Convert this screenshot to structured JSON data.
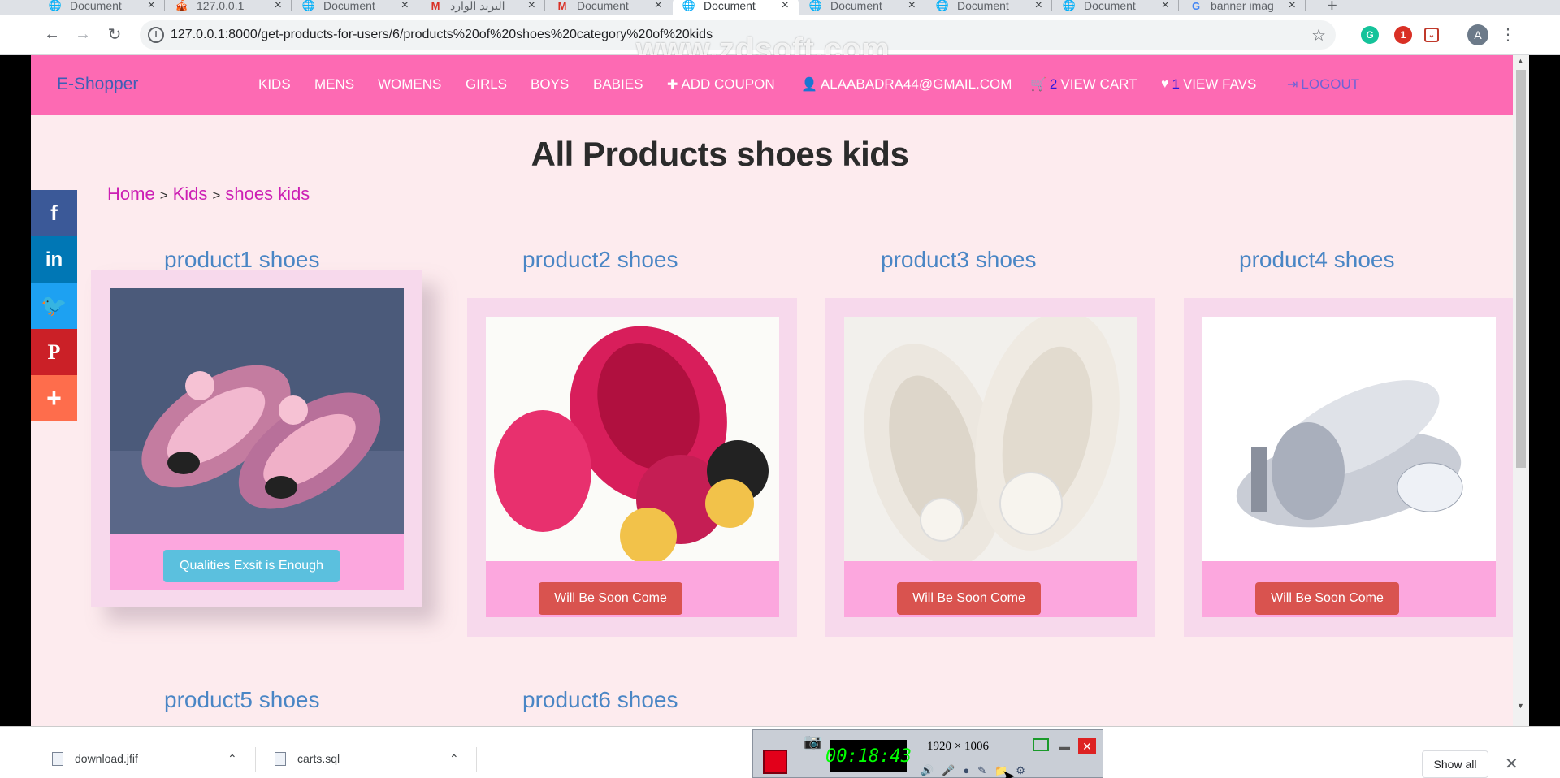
{
  "tabs": [
    {
      "title": "Document",
      "icon": "globe-icon",
      "active": false
    },
    {
      "title": "127.0.0.1",
      "icon": "circus-icon",
      "active": false
    },
    {
      "title": "Document",
      "icon": "globe-icon",
      "active": false
    },
    {
      "title": "البريد الوارد",
      "icon": "gmail-icon",
      "active": false
    },
    {
      "title": "Document",
      "icon": "gmail-icon",
      "active": false
    },
    {
      "title": "Document",
      "icon": "globe-icon",
      "active": true
    },
    {
      "title": "Document",
      "icon": "globe-icon",
      "active": false
    },
    {
      "title": "Document",
      "icon": "globe-icon",
      "active": false
    },
    {
      "title": "Document",
      "icon": "globe-icon",
      "active": false
    },
    {
      "title": "banner imag",
      "icon": "google-icon",
      "active": false
    }
  ],
  "toolbar": {
    "url": "127.0.0.1:8000/get-products-for-users/6/products%20of%20shoes%20category%20of%20kids",
    "watermark": "www.zdsoft.com",
    "avatar_letter": "A",
    "ext_badge": "1"
  },
  "navbar": {
    "brand": "E-Shopper",
    "items": [
      {
        "label": "KIDS"
      },
      {
        "label": "MENS"
      },
      {
        "label": "WOMENS"
      },
      {
        "label": "GIRLS"
      },
      {
        "label": "BOYS"
      },
      {
        "label": "BABIES"
      }
    ],
    "add_coupon": "ADD COUPON",
    "user_email": "ALAABADRA44@GMAIL.COM",
    "cart_count": "2",
    "cart_label": "VIEW CART",
    "favs_count": "1",
    "favs_label": "VIEW FAVS",
    "logout": "LOGOUT"
  },
  "main": {
    "title": "All Products shoes kids",
    "breadcrumb": {
      "home": "Home",
      "kids": "Kids",
      "current": "shoes kids",
      "separator": ">"
    }
  },
  "products": [
    {
      "name": "product1 shoes",
      "button": "Qualities Exsit is Enough",
      "button_style": "info"
    },
    {
      "name": "product2 shoes",
      "button": "Will Be Soon Come",
      "button_style": "danger"
    },
    {
      "name": "product3 shoes",
      "button": "Will Be Soon Come",
      "button_style": "danger"
    },
    {
      "name": "product4 shoes",
      "button": "Will Be Soon Come",
      "button_style": "danger"
    },
    {
      "name": "product5 shoes"
    },
    {
      "name": "product6 shoes"
    }
  ],
  "share": [
    {
      "icon": "facebook-icon",
      "glyph": "f",
      "color": "#3b5998"
    },
    {
      "icon": "linkedin-icon",
      "glyph": "in",
      "color": "#0077b5"
    },
    {
      "icon": "twitter-icon",
      "glyph": "t",
      "color": "#1da1f2"
    },
    {
      "icon": "pinterest-icon",
      "glyph": "P",
      "color": "#cb2027"
    },
    {
      "icon": "more-icon",
      "glyph": "+",
      "color": "#fe6d4c"
    }
  ],
  "downloads": [
    {
      "name": "download.jfif"
    },
    {
      "name": "carts.sql"
    }
  ],
  "downloads_show_all": "Show all",
  "recorder": {
    "time": "00:18:43",
    "dimensions": "1920 × 1006"
  },
  "colors": {
    "navbar": "#fd6ab3",
    "page_bg": "#fdebee",
    "brand": "#3d5fb5",
    "product_title": "#4a86c5",
    "breadcrumb": "#cc1fb4",
    "btn_info": "#5bc0de",
    "btn_danger": "#d9534f"
  }
}
